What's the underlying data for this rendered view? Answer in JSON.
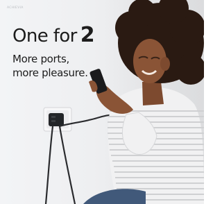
{
  "brand": {
    "text": "ACHIEVIA"
  },
  "headline": {
    "text": "One for",
    "number": "2"
  },
  "subline": {
    "line1": "More ports,",
    "line2": "more pleasure."
  },
  "colors": {
    "text": "#1c1c1c",
    "wall": "#eeeff1",
    "skin": "#8a5436",
    "hair": "#2a1a12",
    "shirt_stripe": "#cfd0d2",
    "charger": "#232528"
  },
  "icons": [
    "wall-socket-icon",
    "charger-icon",
    "cable-icon",
    "phone-icon"
  ]
}
